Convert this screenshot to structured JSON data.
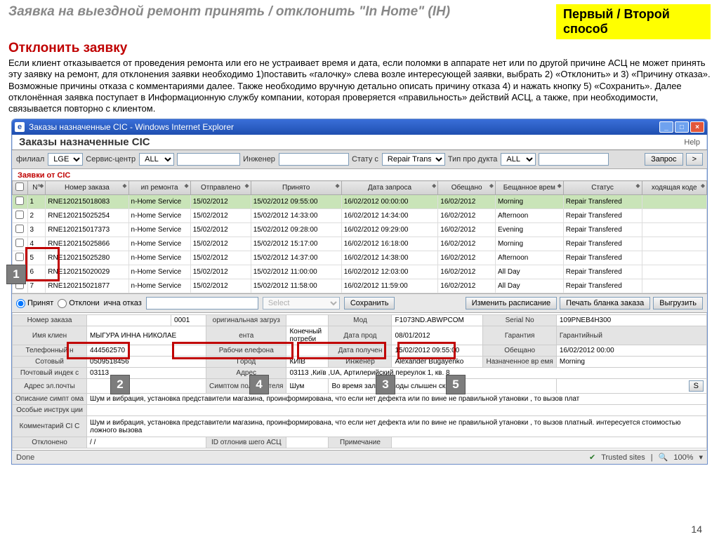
{
  "title": "Заявка на выездной ремонт принять / отклонить \"In Home\" (IH)",
  "tag": "Первый / Второй способ",
  "subtitle": "Отклонить заявку",
  "bodytext": "Если клиент отказывается от проведения ремонта или его не устраивает время и дата,  если поломки в аппарате нет или по другой причине АСЦ не может принять эту заявку на ремонт,  для отклонения заявки необходимо  1)поставить «галочку» слева возле интересующей заявки,  выбрать 2) «Отклонить»  и 3) «Причину отказа». Возможные причины отказа с комментариями далее. Также необходимо вручную детально описать причину отказа 4) и нажать кнопку  5) «Сохранить». Далее отклонённая заявка поступает в Информационную службу компании, которая проверяется «правильность» действий АСЦ, а также, при необходимости, связывается повторно  с клиентом.",
  "ie": {
    "title": "Заказы назначенные CIC - Windows Internet Explorer",
    "app_header": "Заказы назначенные CIC",
    "help": "Help"
  },
  "filter": {
    "branch_lbl": "филиал",
    "branch": "LGEL",
    "svc_lbl": "Сервис-центр",
    "svc": "ALL",
    "eng_lbl": "Инженер",
    "status_lbl": "Стату с",
    "status": "Repair Transf",
    "ptype_lbl": "Тип про дукта",
    "ptype": "ALL",
    "btn_query": "Запрос",
    "btn_arrow": ">"
  },
  "section": "Заявки от CIC",
  "cols": [
    "",
    "N°",
    "Номер заказа",
    "ип ремонта",
    "Отправлено",
    "Принято",
    "Дата запроса",
    "Обещано",
    "Бещанное врем",
    "Статус",
    "ходящая коде"
  ],
  "rows": [
    {
      "n": "1",
      "ord": "RNE120215018083",
      "type": "n-Home Service",
      "sent": "15/02/2012",
      "recv": "15/02/2012 09:55:00",
      "req": "16/02/2012 00:00:00",
      "prom": "16/02/2012",
      "time": "Morning",
      "status": "Repair Transfered",
      "code": ""
    },
    {
      "n": "2",
      "ord": "RNE120215025254",
      "type": "n-Home Service",
      "sent": "15/02/2012",
      "recv": "15/02/2012 14:33:00",
      "req": "16/02/2012 14:34:00",
      "prom": "16/02/2012",
      "time": "Afternoon",
      "status": "Repair Transfered",
      "code": ""
    },
    {
      "n": "3",
      "ord": "RNE120215017373",
      "type": "n-Home Service",
      "sent": "15/02/2012",
      "recv": "15/02/2012 09:28:00",
      "req": "16/02/2012 09:29:00",
      "prom": "16/02/2012",
      "time": "Evening",
      "status": "Repair Transfered",
      "code": ""
    },
    {
      "n": "4",
      "ord": "RNE120215025866",
      "type": "n-Home Service",
      "sent": "15/02/2012",
      "recv": "15/02/2012 15:17:00",
      "req": "16/02/2012 16:18:00",
      "prom": "16/02/2012",
      "time": "Morning",
      "status": "Repair Transfered",
      "code": ""
    },
    {
      "n": "5",
      "ord": "RNE120215025280",
      "type": "n-Home Service",
      "sent": "15/02/2012",
      "recv": "15/02/2012 14:37:00",
      "req": "16/02/2012 14:38:00",
      "prom": "16/02/2012",
      "time": "Afternoon",
      "status": "Repair Transfered",
      "code": ""
    },
    {
      "n": "6",
      "ord": "RNE120215020029",
      "type": "n-Home Service",
      "sent": "15/02/2012",
      "recv": "15/02/2012 11:00:00",
      "req": "16/02/2012 12:03:00",
      "prom": "16/02/2012",
      "time": "All Day",
      "status": "Repair Transfered",
      "code": ""
    },
    {
      "n": "7",
      "ord": "RNE120215021877",
      "type": "n-Home Service",
      "sent": "15/02/2012",
      "recv": "15/02/2012 11:58:00",
      "req": "16/02/2012 11:59:00",
      "prom": "16/02/2012",
      "time": "All Day",
      "status": "Repair Transfered",
      "code": ""
    }
  ],
  "action": {
    "accept": "Принят",
    "reject": "Отклони",
    "reason_lbl": "ична отказ",
    "select_placeholder": "Select",
    "save": "Сохранить",
    "reschedule": "Изменить расписание",
    "print": "Печать бланка заказа",
    "export": "Выгрузить"
  },
  "detail": {
    "ord_lbl": "Номер заказа",
    "ord": "",
    "ord2_lbl": "",
    "ord2": "0001",
    "load_lbl": "оригинальная загруз",
    "load": "",
    "mod_lbl": "Мод",
    "mod": "F1073ND.ABWPCOM",
    "sn_lbl": "Serial No",
    "sn": "109PNEB4H300",
    "name_lbl": "Имя клиен",
    "name": "МЫГУРА ИННА НИКОЛАЕ",
    "seg_lbl": "ента",
    "seg": "Конечный потреби",
    "sale_lbl": "Дата прод",
    "sale": "08/01/2012",
    "warr_lbl": "Гарантия",
    "warr": "Гарантийный",
    "tel_lbl": "Телефонный н",
    "tel": "444562570",
    "wtel_lbl": "Рабочи елефона",
    "wtel": "",
    "recv_lbl": "Дата получен",
    "recv": "15/02/2012 09:55:00",
    "prom_lbl": "Обещано",
    "prom": "16/02/2012 00:00",
    "mob_lbl": "Сотовый",
    "mob": "0509518456",
    "city_lbl": "Город",
    "city": "КИЇВ",
    "eng_lbl": "Инженер",
    "eng": "Alexander Bugayenko",
    "ptime_lbl": "Назначенное вр емя",
    "ptime": "Morning",
    "zip_lbl": "Почтовый индек с",
    "zip": "03113",
    "addr_lbl": "Адрес",
    "addr": "03113 ,Київ ,UA, Артилерийский переулок 1, кв. 8",
    "email_lbl": "Адрес эл.почты",
    "email": "",
    "sympt_lbl": "Симптом польз вателя",
    "sympt": "Шум",
    "sympt2": "Во время заливки воды слышен скрип",
    "sbtn": "S",
    "desc_lbl": "Описание симпт ома",
    "desc": "Шум и вибрация, установка представители магазина, проинформирована, что если нет дефекта или по вине не правильной утановки , то вызов плат",
    "instr_lbl": "Особые инструк ции",
    "instr": "",
    "ccmt_lbl": "Комментарий CI C",
    "ccmt": "Шум и вибрация, установка представители магазина, проинформирована, что если нет дефекта или по вине не правильной утановки , то вызов платный. интересуется стоимостью ложного вызова",
    "rej_lbl": "Отклонено",
    "rej": "/ /",
    "rejid_lbl": "ID отлонив шего АСЦ",
    "rejid": "",
    "note_lbl": "Примечание",
    "note": ""
  },
  "status": {
    "done": "Done",
    "trusted": "Trusted sites",
    "zoom": "100%"
  },
  "page_num": "14",
  "badges": [
    "1",
    "2",
    "3",
    "4",
    "5"
  ]
}
